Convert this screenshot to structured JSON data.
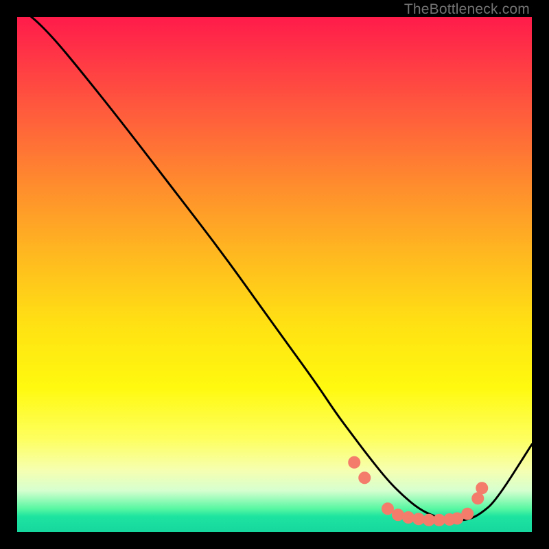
{
  "watermark": "TheBottleneck.com",
  "chart_data": {
    "type": "line",
    "title": "",
    "xlabel": "",
    "ylabel": "",
    "xlim": [
      0,
      100
    ],
    "ylim": [
      0,
      100
    ],
    "series": [
      {
        "name": "curve",
        "x": [
          0,
          3,
          7,
          12,
          20,
          30,
          40,
          50,
          58,
          62,
          65,
          68,
          72,
          75,
          78,
          81,
          84,
          86,
          88,
          90,
          93,
          100
        ],
        "y": [
          102,
          100,
          96,
          90,
          80,
          67,
          54,
          40,
          29,
          23,
          19,
          15,
          10,
          7,
          4.5,
          3,
          2.3,
          2.2,
          2.5,
          3.5,
          6,
          17
        ]
      }
    ],
    "markers": [
      {
        "x": 65.5,
        "y": 13.5
      },
      {
        "x": 67.5,
        "y": 10.5
      },
      {
        "x": 72.0,
        "y": 4.5
      },
      {
        "x": 74.0,
        "y": 3.3
      },
      {
        "x": 76.0,
        "y": 2.8
      },
      {
        "x": 78.0,
        "y": 2.5
      },
      {
        "x": 80.0,
        "y": 2.3
      },
      {
        "x": 82.0,
        "y": 2.3
      },
      {
        "x": 84.0,
        "y": 2.4
      },
      {
        "x": 85.5,
        "y": 2.6
      },
      {
        "x": 87.5,
        "y": 3.5
      },
      {
        "x": 89.5,
        "y": 6.5
      },
      {
        "x": 90.3,
        "y": 8.5
      }
    ],
    "colors": {
      "curve": "#000000",
      "marker": "#f47c6b",
      "gradient_top": "#ff1b4a",
      "gradient_mid": "#ffe213",
      "gradient_bottom": "#16d79e"
    }
  }
}
